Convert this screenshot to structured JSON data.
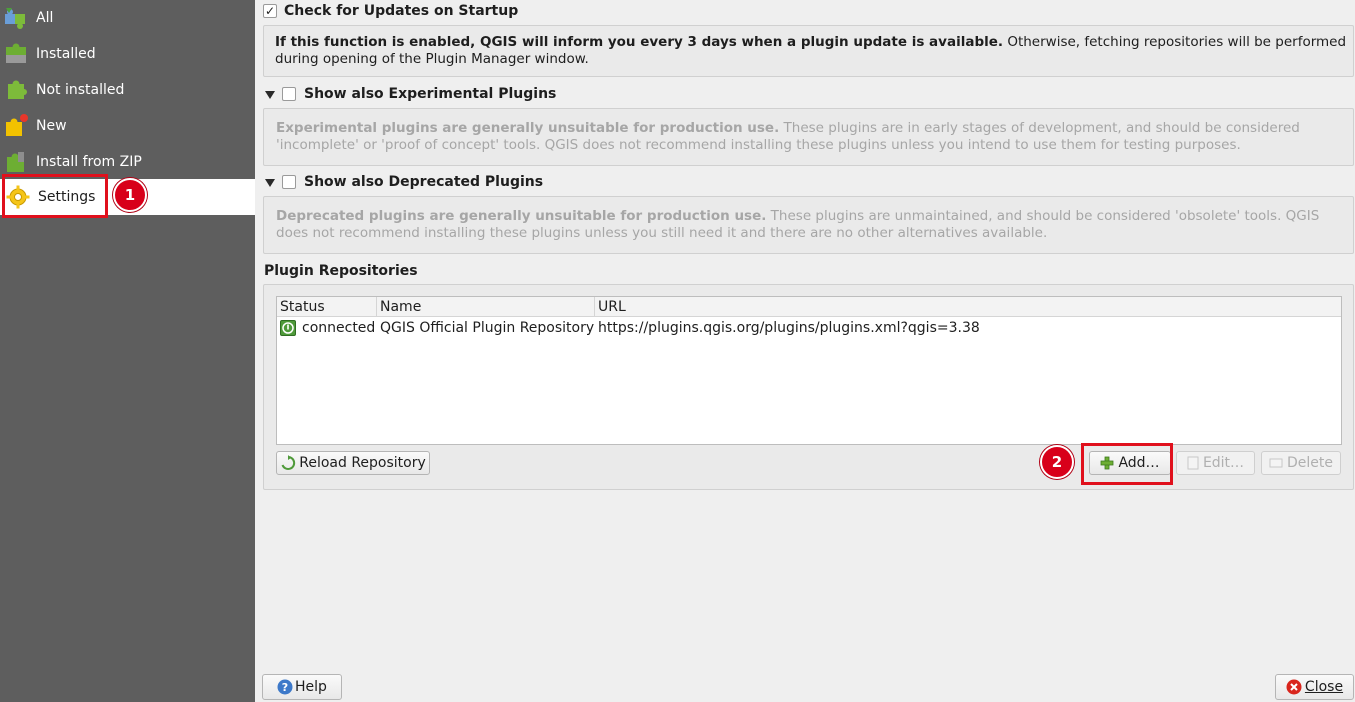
{
  "sidebar": {
    "items": [
      {
        "label": "All",
        "icon": "puzzle-all-icon"
      },
      {
        "label": "Installed",
        "icon": "puzzle-installed-icon"
      },
      {
        "label": "Not installed",
        "icon": "puzzle-not-installed-icon"
      },
      {
        "label": "New",
        "icon": "puzzle-new-icon"
      },
      {
        "label": "Install from ZIP",
        "icon": "puzzle-zip-icon"
      },
      {
        "label": "Settings",
        "icon": "gear-icon",
        "selected": true
      }
    ]
  },
  "annotations": {
    "badge1": "1",
    "badge2": "2",
    "highlight_color": "#e0101c"
  },
  "settings": {
    "check_updates": {
      "label": "Check for Updates on Startup",
      "checked": true,
      "desc_bold": "If this function is enabled, QGIS will inform you every 3 days when a plugin update is available.",
      "desc_rest": " Otherwise, fetching repositories will be performed during opening of the Plugin Manager window."
    },
    "experimental": {
      "label": "Show also Experimental Plugins",
      "checked": false,
      "desc_bold": "Experimental plugins are generally unsuitable for production use.",
      "desc_rest": " These plugins are in early stages of development, and should be considered 'incomplete' or 'proof of concept' tools. QGIS does not recommend installing these plugins unless you intend to use them for testing purposes."
    },
    "deprecated": {
      "label": "Show also Deprecated Plugins",
      "checked": false,
      "desc_bold": "Deprecated plugins are generally unsuitable for production use.",
      "desc_rest": " These plugins are unmaintained, and should be considered 'obsolete' tools. QGIS does not recommend installing these plugins unless you still need it and there are no other alternatives available."
    }
  },
  "repositories": {
    "title": "Plugin Repositories",
    "columns": [
      "Status",
      "Name",
      "URL"
    ],
    "rows": [
      {
        "status": "connected",
        "name": "QGIS Official Plugin Repository",
        "url": "https://plugins.qgis.org/plugins/plugins.xml?qgis=3.38"
      }
    ],
    "buttons": {
      "reload": "Reload Repository",
      "add": "Add…",
      "edit": "Edit…",
      "delete": "Delete"
    }
  },
  "footer": {
    "help": "Help",
    "close": "Close"
  }
}
